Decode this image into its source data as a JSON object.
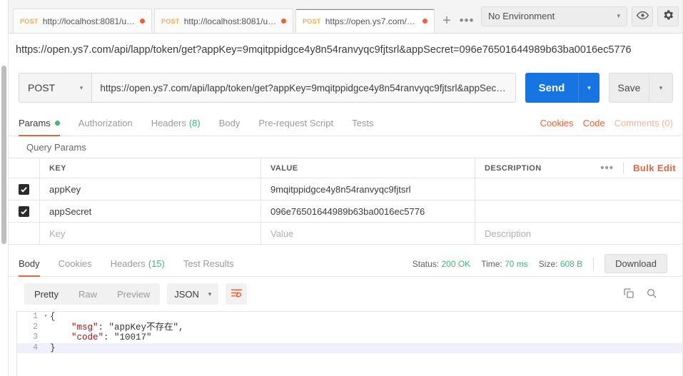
{
  "window": {
    "tabs": [
      {
        "method": "POST",
        "url": "http://localhost:8081/us...",
        "active": false,
        "unsaved": true
      },
      {
        "method": "POST",
        "url": "http://localhost:8081/us...",
        "active": false,
        "unsaved": true
      },
      {
        "method": "POST",
        "url": "https://open.ys7.com/a...",
        "active": true,
        "unsaved": true
      }
    ],
    "new_tab_label": "+",
    "tab_more_label": "•••",
    "environment": {
      "selected": "No Environment",
      "caret": "▾"
    },
    "eye_icon": "eye-icon",
    "gear_icon": "gear-icon"
  },
  "address": {
    "full_url": "https://open.ys7.com/api/lapp/token/get?appKey=9mqitppidgce4y8n54ranvyqc9fjtsrl&appSecret=096e76501644989b63ba0016ec5776"
  },
  "request": {
    "method": "POST",
    "method_caret": "▾",
    "url_value": "https://open.ys7.com/api/lapp/token/get?appKey=9mqitppidgce4y8n54ranvyqc9fjtsrl&appSecret=096e7...",
    "send_label": "Send",
    "send_caret": "▾",
    "save_label": "Save",
    "save_caret": "▾",
    "tabs": [
      {
        "label": "Params",
        "active": true,
        "dot": true
      },
      {
        "label": "Authorization",
        "active": false
      },
      {
        "label": "Headers",
        "active": false,
        "count": "(8)"
      },
      {
        "label": "Body",
        "active": false
      },
      {
        "label": "Pre-request Script",
        "active": false
      },
      {
        "label": "Tests",
        "active": false
      }
    ],
    "right_links": [
      {
        "label": "Cookies",
        "muted": false
      },
      {
        "label": "Code",
        "muted": false
      },
      {
        "label": "Comments (0)",
        "muted": true
      }
    ]
  },
  "query_params": {
    "section_title": "Query Params",
    "columns": {
      "key": "KEY",
      "value": "VALUE",
      "description": "DESCRIPTION"
    },
    "more_label": "•••",
    "bulk_edit_label": "Bulk Edit",
    "rows": [
      {
        "checked": true,
        "key": "appKey",
        "value": "9mqitppidgce4y8n54ranvyqc9fjtsrl",
        "description": ""
      },
      {
        "checked": true,
        "key": "appSecret",
        "value": "096e76501644989b63ba0016ec5776",
        "description": ""
      }
    ],
    "empty_row": {
      "key": "Key",
      "value": "Value",
      "description": "Description"
    }
  },
  "response": {
    "tabs": [
      {
        "label": "Body",
        "active": true
      },
      {
        "label": "Cookies",
        "active": false
      },
      {
        "label": "Headers",
        "active": false,
        "count": "(15)"
      },
      {
        "label": "Test Results",
        "active": false
      }
    ],
    "status_label": "Status:",
    "status_value": "200 OK",
    "time_label": "Time:",
    "time_value": "70 ms",
    "size_label": "Size:",
    "size_value": "608 B",
    "download_label": "Download",
    "format_tabs": [
      {
        "label": "Pretty",
        "active": true
      },
      {
        "label": "Raw",
        "active": false
      },
      {
        "label": "Preview",
        "active": false
      }
    ],
    "content_type": "JSON",
    "content_type_caret": "▾",
    "wrap_icon": "word-wrap-icon",
    "copy_icon": "copy-icon",
    "search_icon": "search-icon",
    "body_lines": [
      {
        "num": "1",
        "fold": "▾",
        "text": "{",
        "highlight": false
      },
      {
        "num": "2",
        "fold": "",
        "text": "    \"msg\": \"appKey不存在\",",
        "highlight": false
      },
      {
        "num": "3",
        "fold": "",
        "text": "    \"code\": \"10017\"",
        "highlight": false
      },
      {
        "num": "4",
        "fold": "",
        "text": "}",
        "highlight": true
      }
    ],
    "body_json": {
      "msg": "appKey不存在",
      "code": "10017"
    }
  },
  "colors": {
    "accent_orange": "#e8643c",
    "method_orange": "#f0ad4e",
    "send_blue": "#1675e0",
    "success_green": "#3cb878",
    "string_purple": "#7a3e9d",
    "key_red": "#a31515"
  }
}
